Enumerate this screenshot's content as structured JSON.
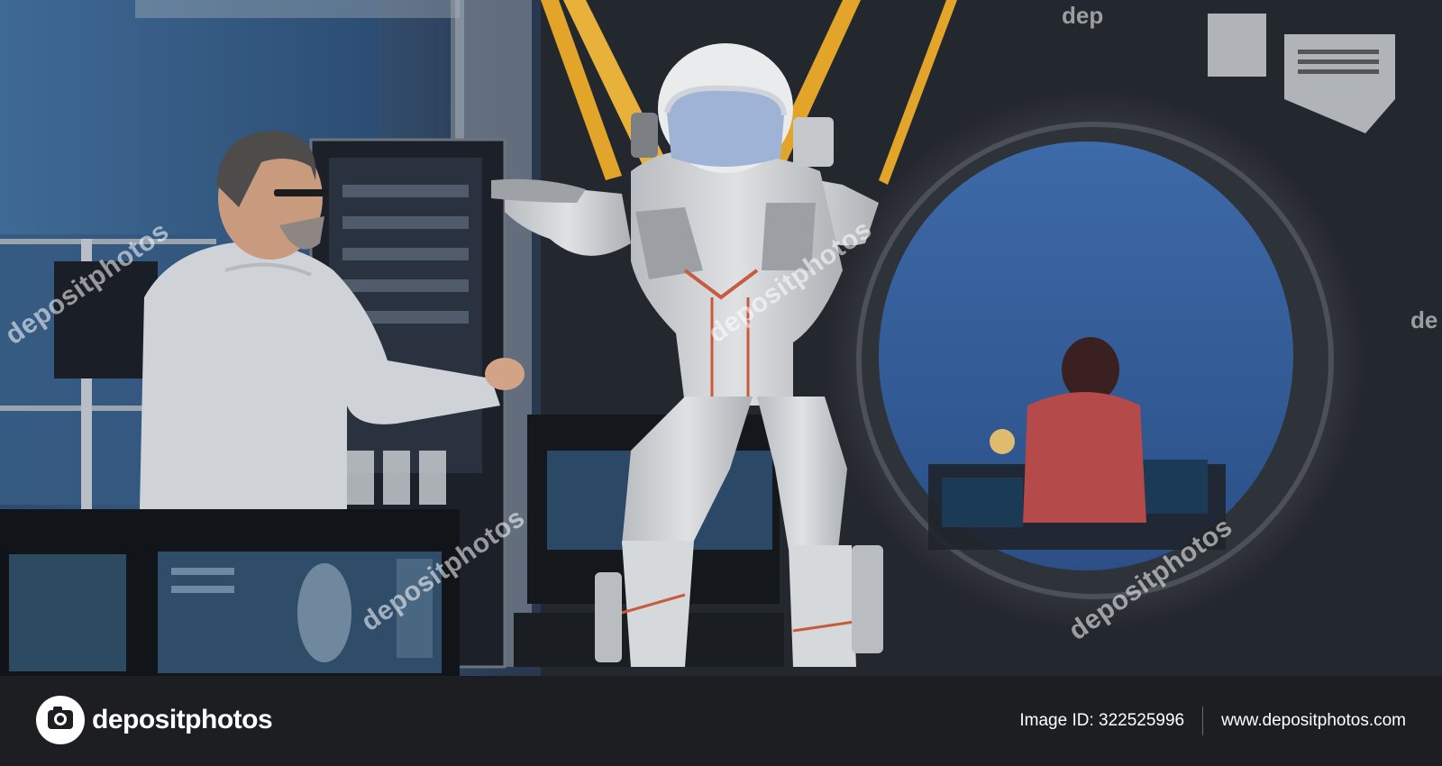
{
  "watermark": {
    "text": "depositphotos",
    "corner_text": "dep",
    "corner_text_right": "de"
  },
  "footer": {
    "logo_text": "depositphotos",
    "image_id_label": "Image ID: 322525996",
    "website": "www.depositphotos.com"
  },
  "colors": {
    "footer_bg": "#1d1e21",
    "strap": "#e2a52a",
    "lab_blue": "#3b5f86"
  }
}
